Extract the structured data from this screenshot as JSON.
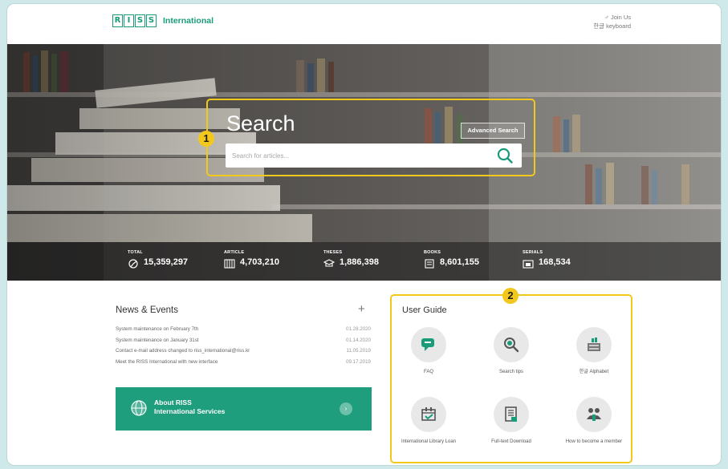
{
  "header": {
    "logo_box": [
      "R",
      "I",
      "S",
      "S"
    ],
    "logo_text": "International",
    "join_us": "♂ Join Us",
    "keyboard": "한글 keyboard"
  },
  "search": {
    "title": "Search",
    "advanced_label": "Advanced Search",
    "placeholder": "Search for articles..."
  },
  "badges": {
    "search": "1",
    "guide": "2"
  },
  "stats": [
    {
      "label": "TOTAL",
      "value": "15,359,297",
      "icon": "total-icon"
    },
    {
      "label": "ARTICLE",
      "value": "4,703,210",
      "icon": "article-icon"
    },
    {
      "label": "THESES",
      "value": "1,886,398",
      "icon": "theses-icon"
    },
    {
      "label": "BOOKS",
      "value": "8,601,155",
      "icon": "books-icon"
    },
    {
      "label": "SERIALS",
      "value": "168,534",
      "icon": "serials-icon"
    }
  ],
  "news": {
    "title": "News & Events",
    "plus": "+",
    "items": [
      {
        "text": "System maintenance on February 7th",
        "date": "01.28.2020"
      },
      {
        "text": "System maintenance on January 31st",
        "date": "01.14.2020"
      },
      {
        "text": "Contact e-mail address changed to riss_international@riss.kr",
        "date": "11.05.2019"
      },
      {
        "text": "Meet the RISS International with new interface",
        "date": "09.17.2019"
      }
    ]
  },
  "about": {
    "line1": "About RISS",
    "line2": "International Services",
    "arrow": "›"
  },
  "guide": {
    "title": "User Guide",
    "items": [
      {
        "label": "FAQ",
        "icon": "faq-icon"
      },
      {
        "label": "Search tips",
        "icon": "search-tips-icon"
      },
      {
        "label": "한글 Alphabet",
        "icon": "alphabet-icon"
      },
      {
        "label": "International Library Loan",
        "icon": "library-loan-icon"
      },
      {
        "label": "Full-text Download",
        "icon": "download-icon"
      },
      {
        "label": "How to become a member",
        "icon": "member-icon"
      }
    ]
  },
  "colors": {
    "brand": "#1a9b7a",
    "highlight": "#f2c81c",
    "about_bg": "#1f9e7d"
  }
}
